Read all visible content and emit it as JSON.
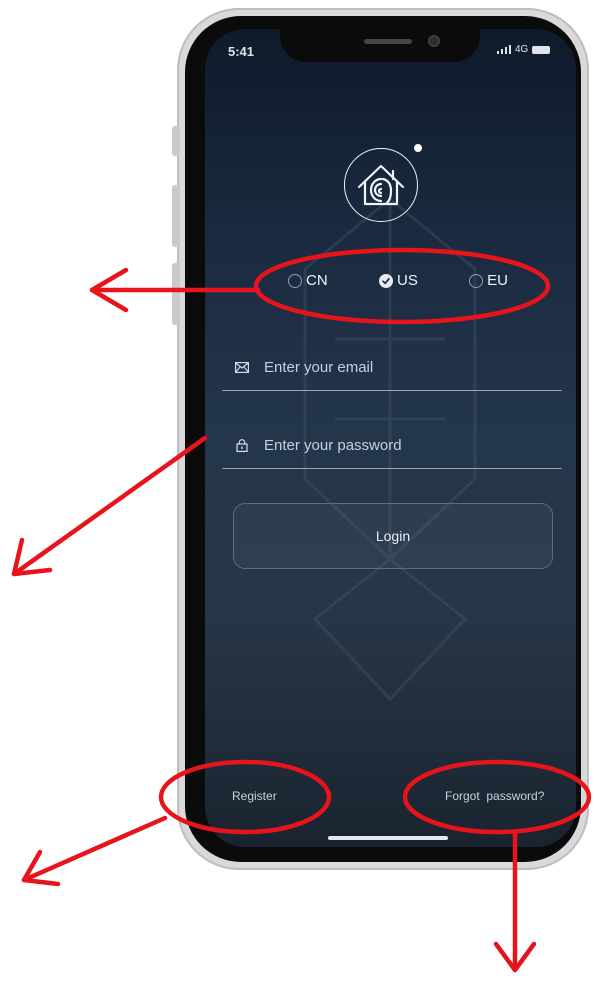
{
  "status_bar": {
    "time": "5:41",
    "network": "4G"
  },
  "region_selector": {
    "options": [
      {
        "label": "CN",
        "selected": false
      },
      {
        "label": "US",
        "selected": true
      },
      {
        "label": "EU",
        "selected": false
      }
    ]
  },
  "email_field": {
    "placeholder": "Enter your email",
    "value": ""
  },
  "password_field": {
    "placeholder": "Enter your password",
    "value": ""
  },
  "login_button": {
    "label": "Login"
  },
  "register_link": {
    "label": "Register"
  },
  "forgot_link": {
    "label": "Forgot  password?"
  },
  "colors": {
    "annotation": "#e8141c",
    "screen_bg": "#1f2f44"
  }
}
